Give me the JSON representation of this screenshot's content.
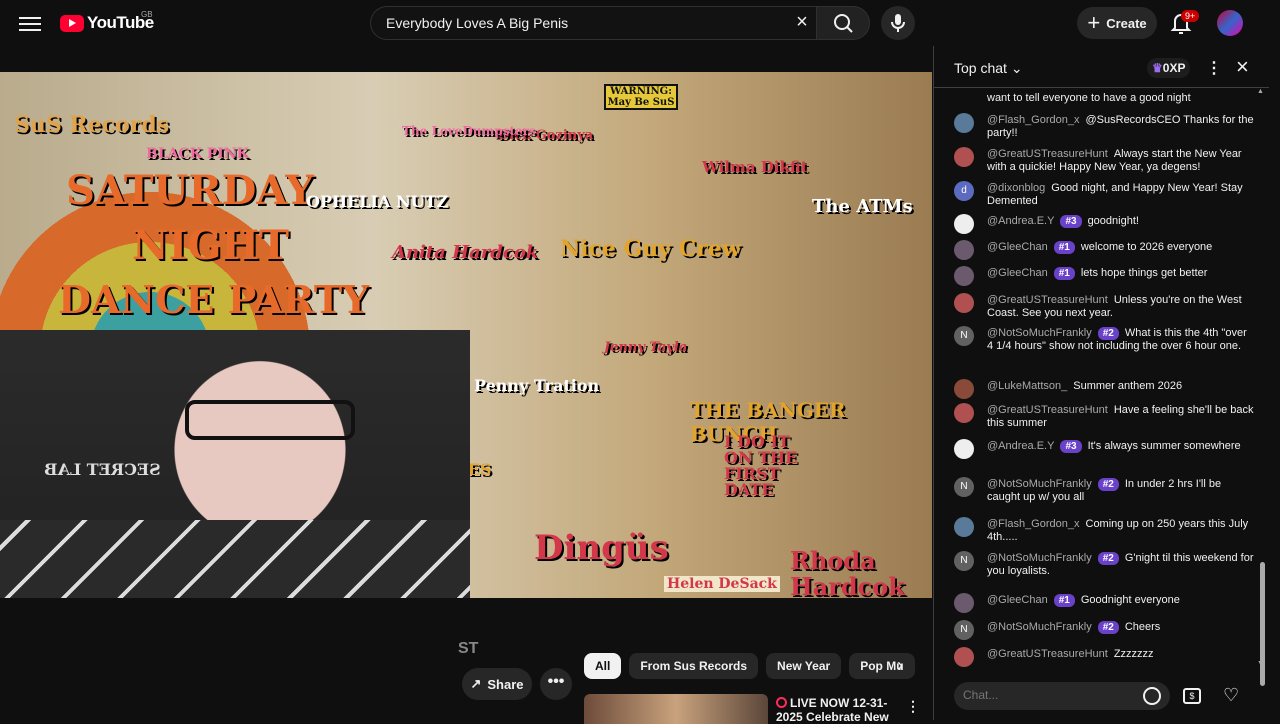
{
  "header": {
    "logo_text": "YouTube",
    "country": "GB",
    "search_value": "Everybody Loves A Big Penis",
    "create_label": "Create",
    "notif_count": "9+"
  },
  "video": {
    "poster_texts": [
      "SuS Records",
      "SATURDAY",
      "NIGHT",
      "DANCE PARTY",
      "OPHELIA NUTZ",
      "Anita Hardcok",
      "Nice Guy Crew",
      "The ATMs",
      "Wilma Dikfit",
      "Dick Gozinya",
      "WARNING: May Be SuS",
      "The LoveDumpsters",
      "BLACK PINK",
      "Penny Tration",
      "Jenny Tayla",
      "THE BANGER BUNCH",
      "TESS TICKLES",
      "Dingüs",
      "I DO IT ON THE FIRST DATE",
      "Helen DeSack",
      "Rhoda Hardcok",
      "SECRET LAB"
    ]
  },
  "below": {
    "title_stub": "ST",
    "share_label": "Share",
    "more_label": "•••",
    "chips": [
      "All",
      "From Sus Records",
      "New Year",
      "Pop Mu"
    ],
    "next_video": {
      "live_label": "LIVE NOW 12-31-",
      "title_rest": "2025 Celebrate New"
    }
  },
  "chat": {
    "header_title": "Top chat",
    "xp": "0XP",
    "input_placeholder": "Chat...",
    "messages": [
      {
        "author": "",
        "badge": "",
        "text": "want to tell everyone to have a good night",
        "avatar": "",
        "color": "#7a6a5a"
      },
      {
        "author": "@Flash_Gordon_x",
        "badge": "",
        "text": "@SusRecordsCEO Thanks for the party!!",
        "avatar": "",
        "color": "#5a7a9a"
      },
      {
        "author": "@GreatUSTreasureHunt",
        "badge": "",
        "text": "Always start the New Year with a quickie! Happy New Year, ya degens!",
        "avatar": "",
        "color": "#b05050"
      },
      {
        "author": "@dixonblog",
        "badge": "",
        "text": "Good night, and Happy New Year! Stay Demented",
        "avatar": "d",
        "color": "#5c6bc0"
      },
      {
        "author": "@Andrea.E.Y",
        "badge": "#3",
        "text": "goodnight!",
        "avatar": "",
        "color": "#eeeeee"
      },
      {
        "author": "@GleeChan",
        "badge": "#1",
        "text": "welcome to 2026 everyone",
        "avatar": "",
        "color": "#6b5a6e"
      },
      {
        "author": "@GleeChan",
        "badge": "#1",
        "text": "lets hope things get better",
        "avatar": "",
        "color": "#6b5a6e"
      },
      {
        "author": "@GreatUSTreasureHunt",
        "badge": "",
        "text": "Unless you're on the West Coast. See you next year.",
        "avatar": "",
        "color": "#b05050"
      },
      {
        "author": "@NotSoMuchFrankly",
        "badge": "#2",
        "text": "What is this the 4th \"over 4 1/4 hours\" show not including the over 6 hour one.",
        "avatar": "N",
        "color": "#616161"
      },
      {
        "author": "@LukeMattson_",
        "badge": "",
        "text": "Summer anthem 2026",
        "avatar": "",
        "color": "#8a4a3a"
      },
      {
        "author": "@GreatUSTreasureHunt",
        "badge": "",
        "text": "Have a feeling she'll be back this summer",
        "avatar": "",
        "color": "#b05050"
      },
      {
        "author": "@Andrea.E.Y",
        "badge": "#3",
        "text": "It's always summer somewhere",
        "avatar": "",
        "color": "#eeeeee"
      },
      {
        "author": "@NotSoMuchFrankly",
        "badge": "#2",
        "text": "In under 2 hrs I'll be caught up w/ you all",
        "avatar": "N",
        "color": "#616161"
      },
      {
        "author": "@Flash_Gordon_x",
        "badge": "",
        "text": "Coming up on 250 years this July 4th.....",
        "avatar": "",
        "color": "#5a7a9a"
      },
      {
        "author": "@NotSoMuchFrankly",
        "badge": "#2",
        "text": "G'night til this weekend for you loyalists.",
        "avatar": "N",
        "color": "#616161"
      },
      {
        "author": "@GleeChan",
        "badge": "#1",
        "text": "Goodnight everyone",
        "avatar": "",
        "color": "#6b5a6e"
      },
      {
        "author": "@NotSoMuchFrankly",
        "badge": "#2",
        "text": "Cheers",
        "avatar": "N",
        "color": "#616161"
      },
      {
        "author": "@GreatUSTreasureHunt",
        "badge": "",
        "text": "Zzzzzzz",
        "avatar": "",
        "color": "#b05050"
      }
    ]
  }
}
